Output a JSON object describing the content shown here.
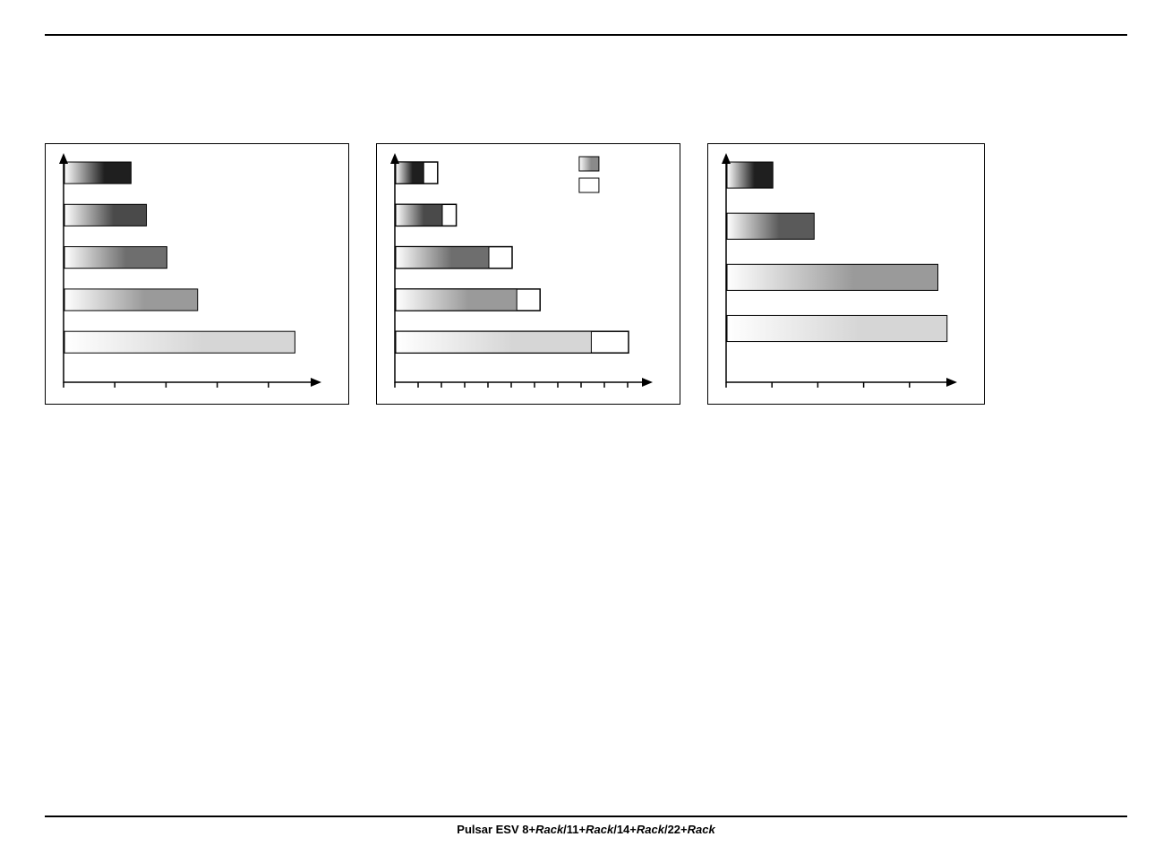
{
  "footer": {
    "prefix": "Pulsar ESV 8+",
    "rack": "Rack",
    "sep1": "/11+",
    "sep2": "/14+",
    "sep3": "/22+"
  },
  "chart_data": [
    {
      "type": "bar",
      "orientation": "horizontal",
      "xlim": [
        0,
        50
      ],
      "x_ticks": [
        0,
        10,
        20,
        30,
        40,
        50
      ],
      "series": [
        {
          "name": "filled",
          "values": [
            13,
            16,
            20,
            26,
            45
          ]
        }
      ],
      "shades": [
        "#1f1f1f",
        "#4a4a4a",
        "#6e6e6e",
        "#9a9a9a",
        "#d6d6d6"
      ]
    },
    {
      "type": "bar",
      "orientation": "horizontal",
      "xlim": [
        0,
        110
      ],
      "x_ticks": [
        0,
        10,
        20,
        30,
        40,
        50,
        60,
        70,
        80,
        90,
        100,
        110
      ],
      "series": [
        {
          "name": "filled",
          "values": [
            12,
            20,
            40,
            52,
            84
          ]
        },
        {
          "name": "outline",
          "values": [
            18,
            26,
            50,
            62,
            100
          ]
        }
      ],
      "legend": [
        "filled",
        "outline"
      ],
      "shades": [
        "#1f1f1f",
        "#4a4a4a",
        "#6e6e6e",
        "#9a9a9a",
        "#d6d6d6"
      ]
    },
    {
      "type": "bar",
      "orientation": "horizontal",
      "xlim": [
        0,
        50
      ],
      "x_ticks": [
        0,
        10,
        20,
        30,
        40,
        50
      ],
      "series": [
        {
          "name": "filled",
          "values": [
            10,
            19,
            46,
            48
          ]
        }
      ],
      "shades": [
        "#1f1f1f",
        "#5a5a5a",
        "#9a9a9a",
        "#d6d6d6"
      ]
    }
  ]
}
